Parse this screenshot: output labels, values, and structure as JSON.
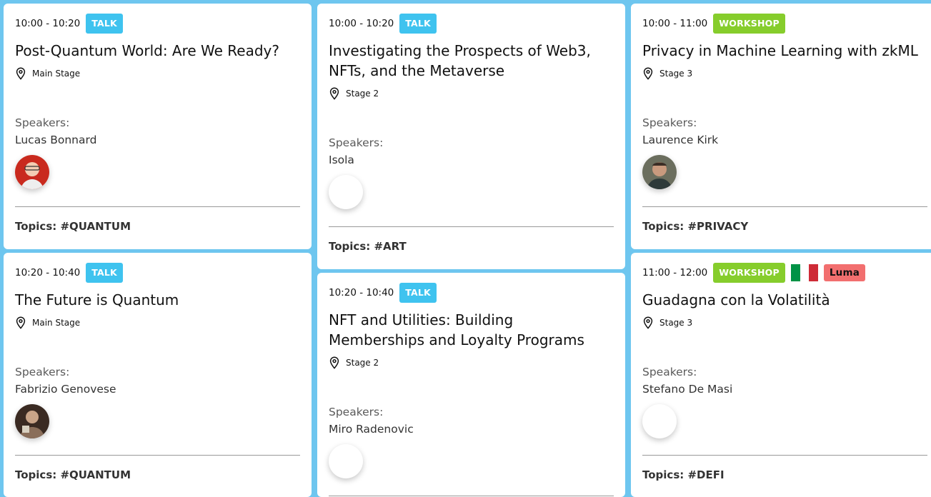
{
  "sessions": [
    {
      "time": "10:00 - 10:20",
      "type": "TALK",
      "title": "Post-Quantum World: Are We Ready?",
      "location": "Main Stage",
      "speakers_label": "Speakers:",
      "speaker": "Lucas Bonnard",
      "topics": "Topics: #QUANTUM"
    },
    {
      "time": "10:20 - 10:40",
      "type": "TALK",
      "title": "The Future is Quantum",
      "location": "Main Stage",
      "speakers_label": "Speakers:",
      "speaker": "Fabrizio Genovese",
      "topics": "Topics: #QUANTUM"
    },
    {
      "time": "10:00 - 10:20",
      "type": "TALK",
      "title": "Investigating the Prospects of Web3, NFTs, and the Metaverse",
      "location": "Stage 2",
      "speakers_label": "Speakers:",
      "speaker": "Isola",
      "topics": "Topics: #ART"
    },
    {
      "time": "10:20 - 10:40",
      "type": "TALK",
      "title": "NFT and Utilities: Building Memberships and Loyalty Programs",
      "location": "Stage 2",
      "speakers_label": "Speakers:",
      "speaker": "Miro Radenovic",
      "topics": ""
    },
    {
      "time": "10:00 - 11:00",
      "type": "WORKSHOP",
      "title": "Privacy in Machine Learning with zkML",
      "location": "Stage 3",
      "speakers_label": "Speakers:",
      "speaker": "Laurence Kirk",
      "topics": "Topics: #PRIVACY"
    },
    {
      "time": "11:00 - 12:00",
      "type": "WORKSHOP",
      "extra_tag": "Luma",
      "flag": "italy-flag",
      "title": "Guadagna con la Volatilità",
      "location": "Stage 3",
      "speakers_label": "Speakers:",
      "speaker": "Stefano De Masi",
      "topics": "Topics: #DEFI"
    }
  ],
  "colors": {
    "background": "#6ec6ef",
    "talk_badge": "#3fc3ef",
    "workshop_badge": "#86cd2c",
    "luma_badge": "#f26f6f",
    "flag_green": "#009246",
    "flag_white": "#ffffff",
    "flag_red": "#ce2b37"
  },
  "icons": {
    "location": "map-pin-icon"
  }
}
